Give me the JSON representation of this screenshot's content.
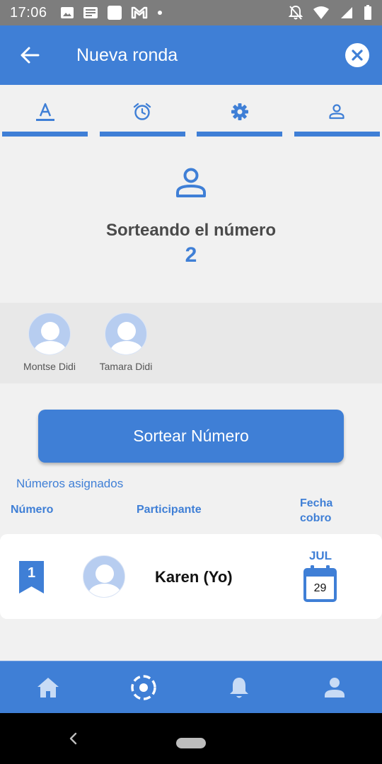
{
  "status_bar": {
    "time": "17:06",
    "icons_left": [
      "image-icon",
      "news-icon",
      "square-icon",
      "gmail-icon",
      "dot-icon"
    ],
    "icons_right": [
      "mute-icon",
      "wifi-icon",
      "signal-icon",
      "battery-icon"
    ]
  },
  "app_bar": {
    "title": "Nueva ronda",
    "back_icon": "arrow-left-icon",
    "close_icon": "close-circle-icon"
  },
  "tabs": [
    {
      "icon": "text-icon",
      "active": true
    },
    {
      "icon": "alarm-icon",
      "active": false
    },
    {
      "icon": "gear-icon",
      "active": false
    },
    {
      "icon": "person-icon",
      "active": false
    }
  ],
  "draw": {
    "title": "Sorteando el número",
    "number": "2"
  },
  "participants": [
    {
      "name": "Montse Didi"
    },
    {
      "name": "Tamara Didi"
    }
  ],
  "draw_button": {
    "label": "Sortear Número"
  },
  "assigned": {
    "title": "Números asignados",
    "columns": {
      "number": "Número",
      "participant": "Participante",
      "date_line1": "Fecha",
      "date_line2": "cobro"
    },
    "rows": [
      {
        "number": "1",
        "participant": "Karen (Yo)",
        "month": "JUL",
        "day": "29"
      }
    ]
  },
  "bottom_nav": [
    {
      "icon": "home-icon"
    },
    {
      "icon": "draw-wheel-icon"
    },
    {
      "icon": "bell-icon"
    },
    {
      "icon": "profile-icon"
    }
  ],
  "colors": {
    "primary": "#3f7fd6",
    "status_bar": "#7d7d7d",
    "background": "#f1f1f1",
    "avatar": "#b7cdf0"
  }
}
